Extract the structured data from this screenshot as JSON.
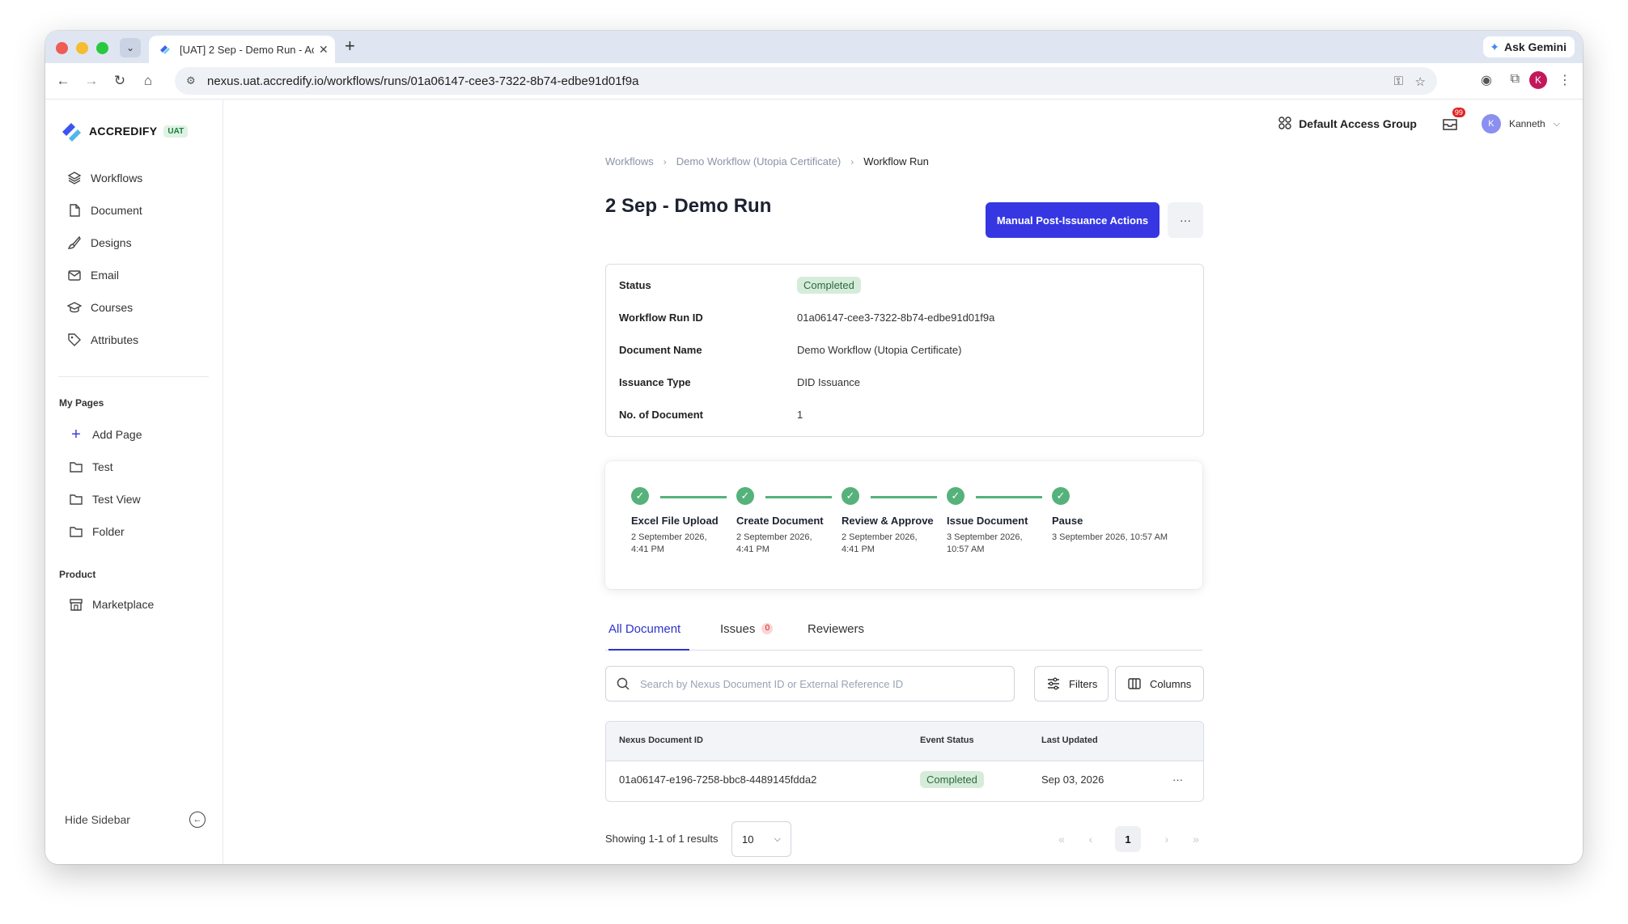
{
  "browser": {
    "tab_title": "[UAT] 2 Sep - Demo Run - Ac",
    "url": "nexus.uat.accredify.io/workflows/runs/01a06147-cee3-7322-8b74-edbe91d01f9a",
    "ask_gemini": "Ask Gemini",
    "profile_initial": "K"
  },
  "brand": {
    "name": "ACCREDIFY",
    "env": "UAT"
  },
  "sidebar": {
    "items": [
      {
        "label": "Workflows",
        "icon": "layers-icon"
      },
      {
        "label": "Document",
        "icon": "file-icon"
      },
      {
        "label": "Designs",
        "icon": "brush-icon"
      },
      {
        "label": "Email",
        "icon": "mail-icon"
      },
      {
        "label": "Courses",
        "icon": "graduation-cap-icon"
      },
      {
        "label": "Attributes",
        "icon": "tag-icon"
      }
    ],
    "my_pages_heading": "My Pages",
    "my_pages": [
      {
        "label": "Add Page",
        "icon": "plus-icon"
      },
      {
        "label": "Test",
        "icon": "folder-icon"
      },
      {
        "label": "Test View",
        "icon": "folder-icon"
      },
      {
        "label": "Folder",
        "icon": "folder-icon"
      }
    ],
    "product_heading": "Product",
    "product": [
      {
        "label": "Marketplace",
        "icon": "store-icon"
      }
    ],
    "hide_label": "Hide Sidebar"
  },
  "topbar": {
    "group": "Default Access Group",
    "notification_count": "99",
    "user_initial": "K",
    "user_name": "Kanneth"
  },
  "breadcrumb": [
    "Workflows",
    "Demo Workflow (Utopia Certificate)",
    "Workflow Run"
  ],
  "page": {
    "title": "2 Sep - Demo Run",
    "primary_action": "Manual Post-Issuance Actions",
    "more": "···"
  },
  "info": {
    "status_label": "Status",
    "status_value": "Completed",
    "run_id_label": "Workflow Run ID",
    "run_id_value": "01a06147-cee3-7322-8b74-edbe91d01f9a",
    "doc_name_label": "Document Name",
    "doc_name_value": "Demo Workflow (Utopia Certificate)",
    "issuance_label": "Issuance Type",
    "issuance_value": "DID Issuance",
    "count_label": "No. of Document",
    "count_value": "1"
  },
  "steps": [
    {
      "name": "Excel File Upload",
      "date_line1": "2 September 2026,",
      "date_line2": "4:41 PM"
    },
    {
      "name": "Create Document",
      "date_line1": "2 September 2026,",
      "date_line2": "4:41 PM"
    },
    {
      "name": "Review & Approve",
      "date_line1": "2 September 2026,",
      "date_line2": "4:41 PM"
    },
    {
      "name": "Issue Document",
      "date_line1": "3 September 2026,",
      "date_line2": "10:57 AM"
    },
    {
      "name": "Pause",
      "date_line1": "3 September 2026, 10:57 AM",
      "date_line2": ""
    }
  ],
  "tabs": {
    "all": "All Document",
    "issues": "Issues",
    "issues_count": "0",
    "reviewers": "Reviewers"
  },
  "search": {
    "placeholder": "Search by Nexus Document ID or External Reference ID"
  },
  "filters_label": "Filters",
  "columns_label": "Columns",
  "table": {
    "headers": [
      "Nexus Document ID",
      "Event Status",
      "Last Updated"
    ],
    "rows": [
      {
        "id": "01a06147-e196-7258-bbc8-4489145fdda2",
        "status": "Completed",
        "updated": "Sep 03, 2026",
        "more": "···"
      }
    ]
  },
  "pagination": {
    "showing": "Showing 1-1 of 1 results",
    "page_size": "10",
    "current_page": "1"
  },
  "colors": {
    "primary": "#3637e3",
    "success": "#55b27a",
    "active_tab": "#2d33c9"
  }
}
